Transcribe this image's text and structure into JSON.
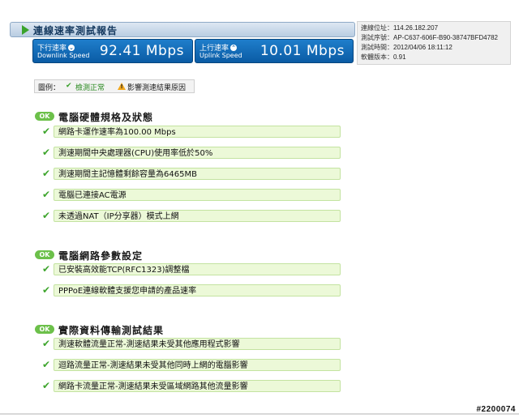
{
  "header": {
    "title": "連線速率測試報告",
    "download": {
      "label_zh": "下行速率",
      "label_en": "Downlink Speed",
      "value": "92.41 Mbps"
    },
    "upload": {
      "label_zh": "上行速率",
      "label_en": "Uplink Speed",
      "value": "10.01 Mbps"
    }
  },
  "info": [
    {
      "key": "連線位址：",
      "value": "114.26.182.207"
    },
    {
      "key": "測試序號：",
      "value": "AP-C637-606F-B90-38747BFD4782"
    },
    {
      "key": "測試時間：",
      "value": "2012/04/06 18:11:12"
    },
    {
      "key": "軟體版本：",
      "value": "0.91"
    }
  ],
  "legend": {
    "label": "圖例：",
    "ok_label": "檢測正常",
    "warn_label": "影響測速結果原因"
  },
  "sections": [
    {
      "badge": "OK",
      "title": "電腦硬體規格及狀態",
      "items": [
        "網路卡運作速率為100.00 Mbps",
        "測速期間中央處理器(CPU)使用率低於50%",
        "測速期間主記憶體剩餘容量為6465MB",
        "電腦已連接AC電源",
        "未透過NAT（IP分享器）模式上網"
      ]
    },
    {
      "badge": "OK",
      "title": "電腦網路參數設定",
      "items": [
        "已安裝高效能TCP(RFC1323)調整檔",
        "PPPoE連線軟體支援您申請的產品速率"
      ]
    },
    {
      "badge": "OK",
      "title": "實際資料傳輸測試結果",
      "items": [
        "測速軟體流量正常-測速結果未受其他應用程式影響",
        "迴路流量正常-測速結果未受其他同時上網的電腦影響",
        "網路卡流量正常-測速結果未受區域網路其他流量影響"
      ]
    }
  ],
  "watermark": "#2200074",
  "colors": {
    "accent_blue": "#0a5ba4",
    "ok_green": "#6cc04a",
    "item_bg": "#ecf9d8",
    "warn": "#f2a71b"
  }
}
